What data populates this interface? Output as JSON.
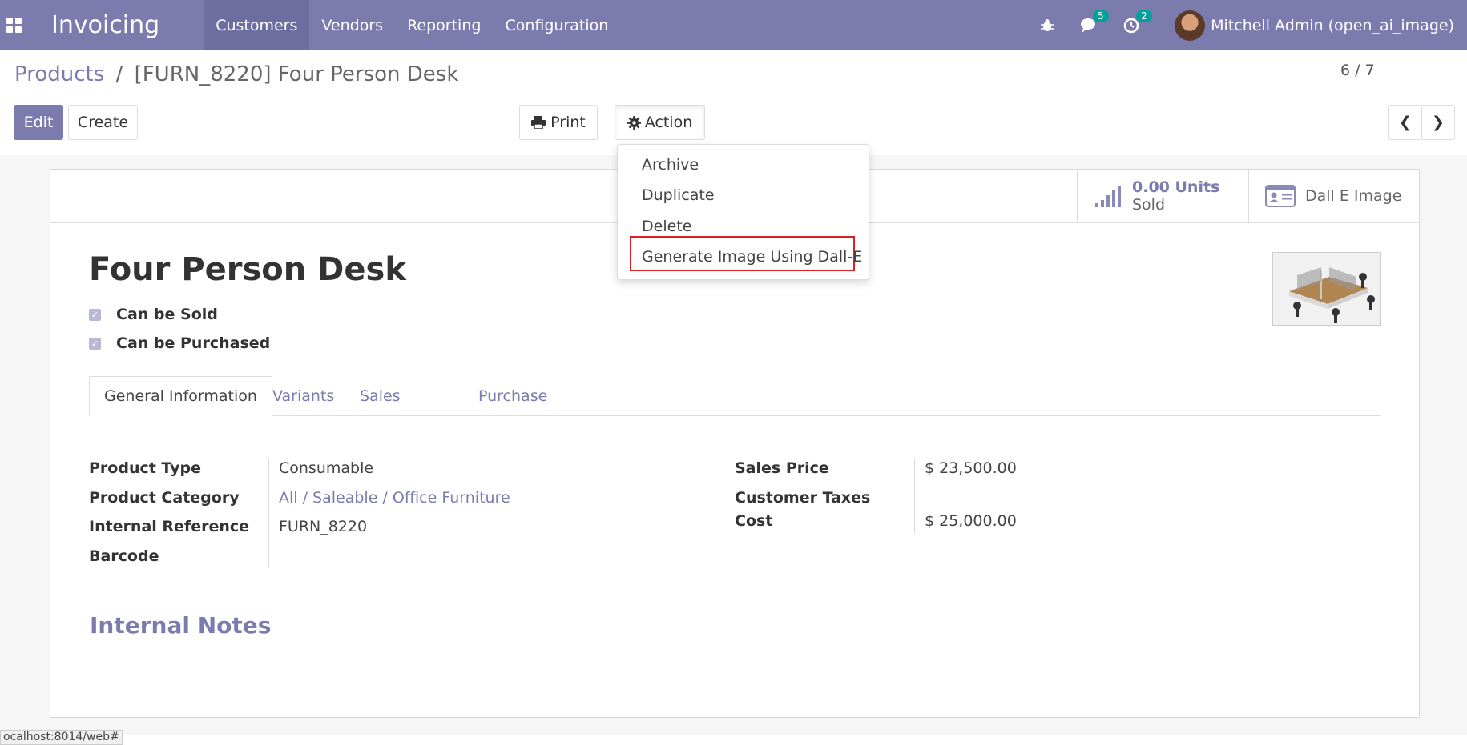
{
  "navbar": {
    "brand": "Invoicing",
    "menu": [
      "Customers",
      "Vendors",
      "Reporting",
      "Configuration"
    ],
    "messages_count": "5",
    "activities_count": "2",
    "user_name": "Mitchell Admin (open_ai_image)",
    "color": "#7c7bad"
  },
  "breadcrumb": {
    "parent": "Products",
    "separator": "/",
    "current": "[FURN_8220] Four Person Desk"
  },
  "buttons": {
    "edit": "Edit",
    "create": "Create",
    "print": "Print",
    "action": "Action"
  },
  "pager": {
    "value": "6 / 7"
  },
  "action_menu": {
    "items": [
      "Archive",
      "Duplicate",
      "Delete",
      "Generate Image Using Dall-E"
    ]
  },
  "stat_buttons": {
    "sold_value": "0.00 Units",
    "sold_label": "Sold",
    "dalle_label": "Dall E Image"
  },
  "product": {
    "name": "Four Person Desk",
    "can_be_sold": "Can be Sold",
    "can_be_purchased": "Can be Purchased"
  },
  "tabs": [
    "General Information",
    "Variants",
    "Sales",
    "Purchase"
  ],
  "fields": {
    "product_type_label": "Product Type",
    "product_type": "Consumable",
    "category_label": "Product Category",
    "category": "All / Saleable / Office Furniture",
    "internal_ref_label": "Internal Reference",
    "internal_ref": "FURN_8220",
    "barcode_label": "Barcode",
    "sales_price_label": "Sales Price",
    "sales_price": "$ 23,500.00",
    "customer_taxes_label": "Customer Taxes",
    "cost_label": "Cost",
    "cost": "$ 25,000.00"
  },
  "internal_notes": "Internal Notes",
  "status_url": "ocalhost:8014/web#"
}
